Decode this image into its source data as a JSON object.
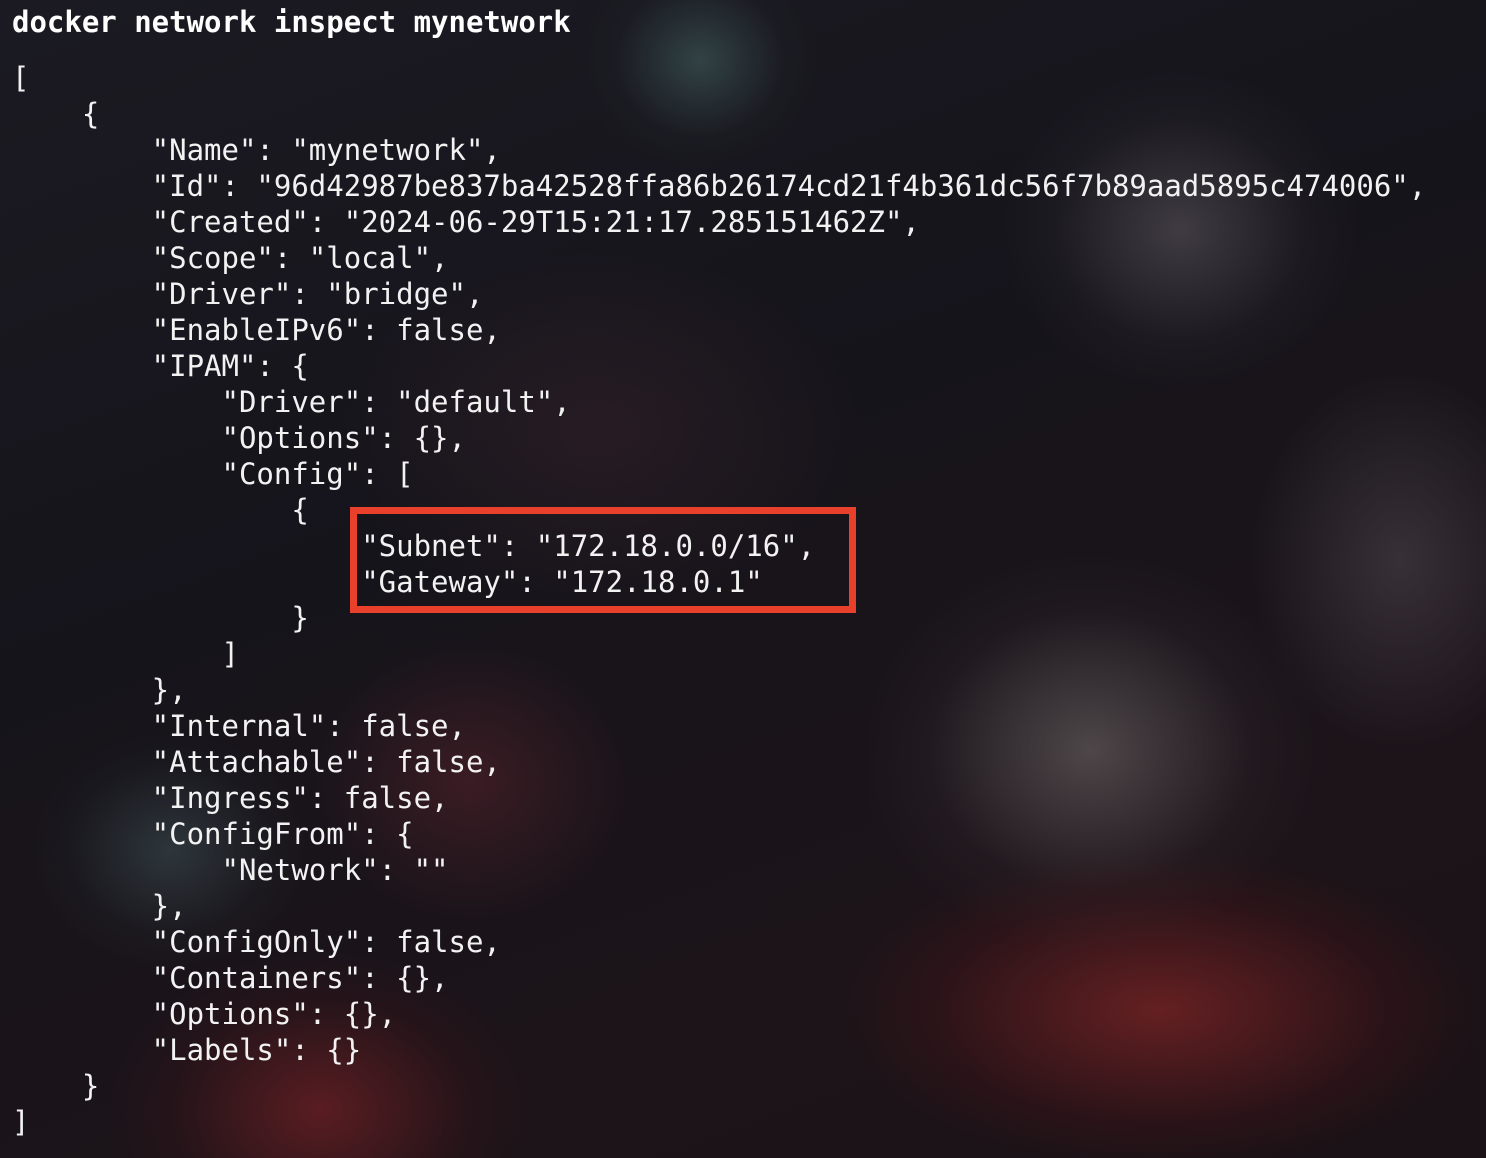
{
  "terminal": {
    "command": "docker network inspect mynetwork",
    "lines": [
      "[",
      "    {",
      "        \"Name\": \"mynetwork\",",
      "        \"Id\": \"96d42987be837ba42528ffa86b26174cd21f4b361dc56f7b89aad5895c474006\",",
      "        \"Created\": \"2024-06-29T15:21:17.285151462Z\",",
      "        \"Scope\": \"local\",",
      "        \"Driver\": \"bridge\",",
      "        \"EnableIPv6\": false,",
      "        \"IPAM\": {",
      "            \"Driver\": \"default\",",
      "            \"Options\": {},",
      "            \"Config\": [",
      "                {",
      "                    \"Subnet\": \"172.18.0.0/16\",",
      "                    \"Gateway\": \"172.18.0.1\"",
      "                }",
      "            ]",
      "        },",
      "        \"Internal\": false,",
      "        \"Attachable\": false,",
      "        \"Ingress\": false,",
      "        \"ConfigFrom\": {",
      "            \"Network\": \"\"",
      "        },",
      "        \"ConfigOnly\": false,",
      "        \"Containers\": {},",
      "        \"Options\": {},",
      "        \"Labels\": {}",
      "    }",
      "]"
    ]
  },
  "colors": {
    "text": "#f2f2f2",
    "highlight": "#e8402b"
  }
}
